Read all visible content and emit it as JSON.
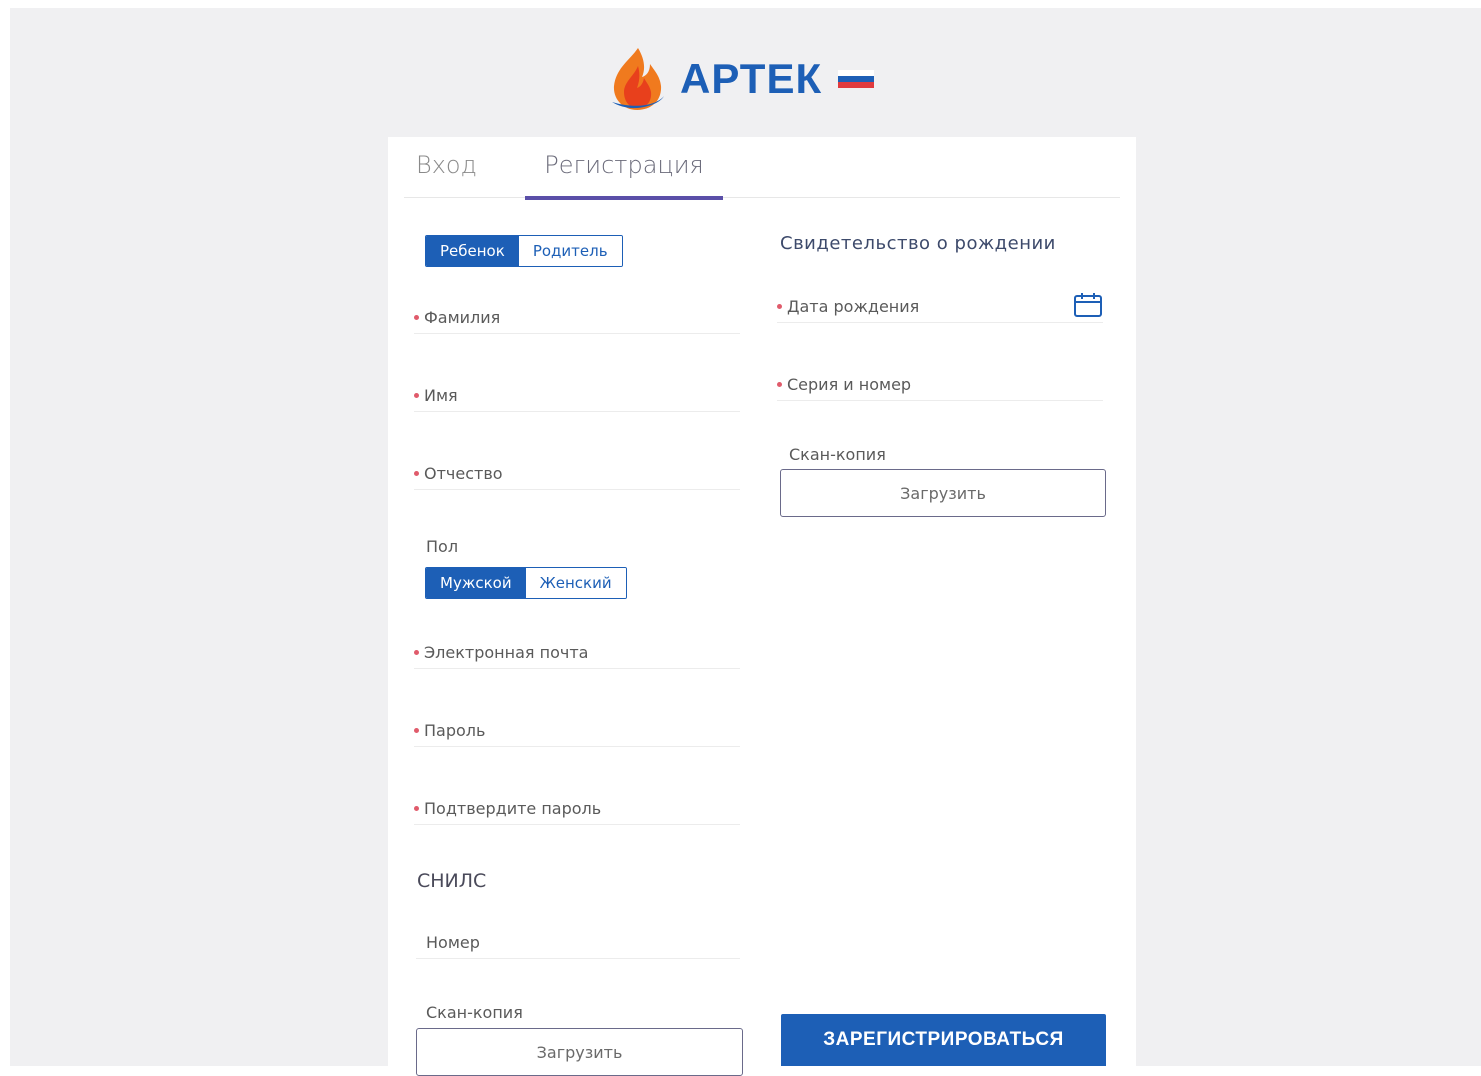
{
  "brand": {
    "name": "АРТЕК",
    "flag_colors": [
      "#ffffff",
      "#1d5fb6",
      "#e03a3e"
    ]
  },
  "tabs": [
    {
      "label": "Вход",
      "active": false
    },
    {
      "label": "Регистрация",
      "active": true
    }
  ],
  "role_toggle": {
    "options": [
      "Ребенок",
      "Родитель"
    ],
    "selected": "Ребенок"
  },
  "left_fields": [
    {
      "label": "Фамилия",
      "required": true
    },
    {
      "label": "Имя",
      "required": true
    },
    {
      "label": "Отчество",
      "required": true
    }
  ],
  "gender": {
    "label": "Пол",
    "options": [
      "Мужской",
      "Женский"
    ],
    "selected": "Мужской"
  },
  "account_fields": [
    {
      "label": "Электронная почта",
      "required": true
    },
    {
      "label": "Пароль",
      "required": true
    },
    {
      "label": "Подтвердите пароль",
      "required": true
    }
  ],
  "snils": {
    "title": "СНИЛС",
    "number_label": "Номер",
    "scan_label": "Скан-копия",
    "upload_label": "Загрузить"
  },
  "birth_certificate": {
    "title": "Свидетельство о рождении",
    "birth_date_label": "Дата рождения",
    "series_label": "Серия и номер",
    "scan_label": "Скан-копия",
    "upload_label": "Загрузить",
    "calendar_icon": "calendar-icon"
  },
  "submit_label": "ЗАРЕГИСТРИРОВАТЬСЯ",
  "colors": {
    "primary": "#1d5fb6",
    "tab_underline": "#5a4fa8",
    "required_dot": "#e05b6b"
  }
}
